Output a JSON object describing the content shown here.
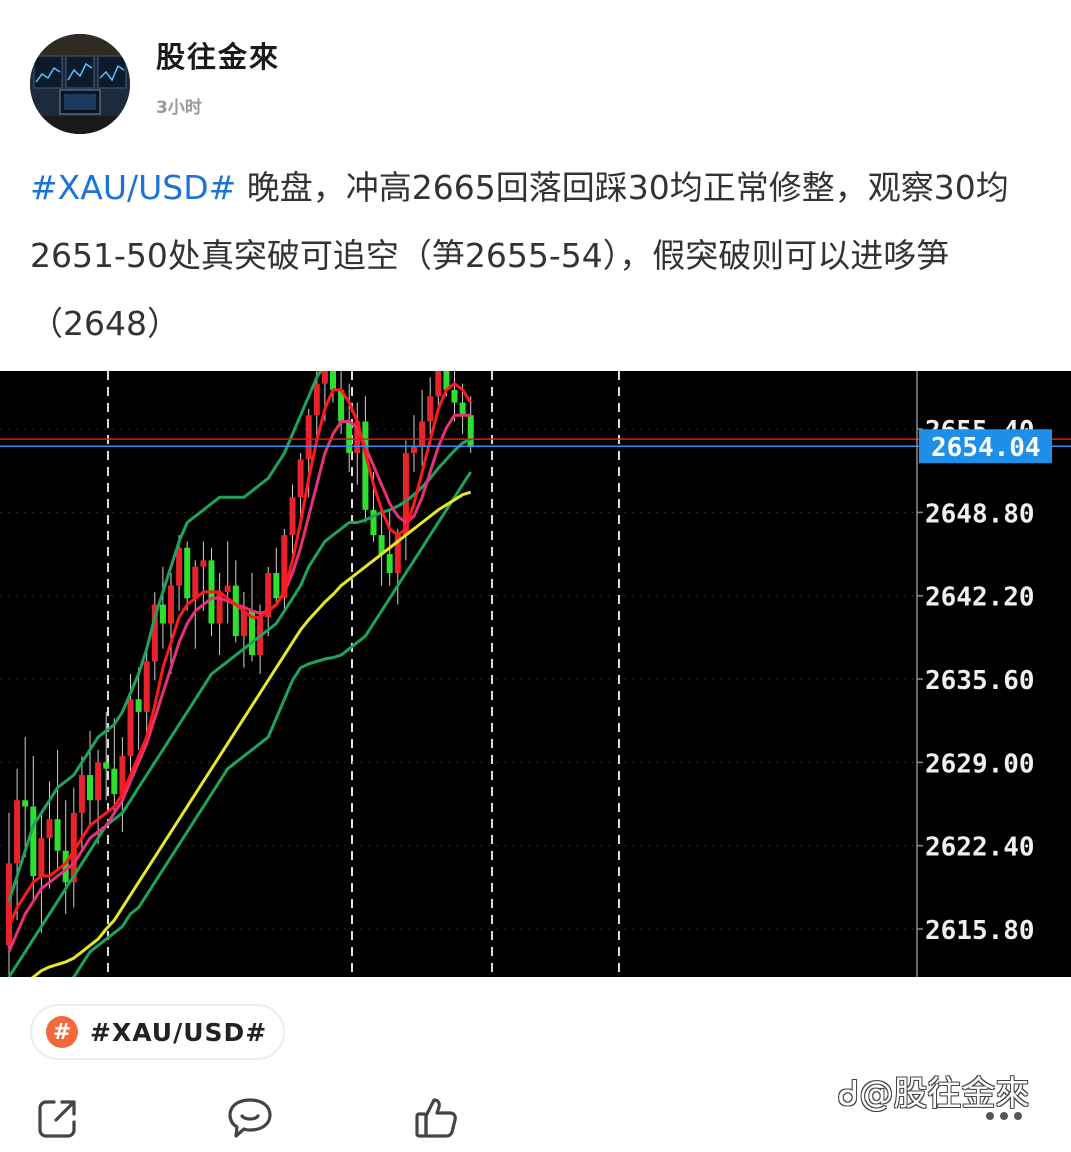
{
  "author": {
    "name": "股往金來",
    "time": "3小时"
  },
  "post": {
    "hashtag": "#XAU/USD#",
    "body": " 晚盘，冲高2665回落回踩30均正常修整，观察30均2651-50处真突破可追空（笋2655-54），假突破则可以进哆笋（2648）"
  },
  "chart_data": {
    "type": "candlestick",
    "symbol": "XAU/USD",
    "y_ticks": [
      "2615.80",
      "2622.40",
      "2629.00",
      "2635.60",
      "2642.20",
      "2648.80",
      "2655.40"
    ],
    "ylim": [
      2612.0,
      2660.0
    ],
    "current_price": "2654.04",
    "current_price_value": 2654.04,
    "red_line_value": 2654.6,
    "colors": {
      "up": "#e8232b",
      "down": "#2ee02e",
      "ma_fast": "#ff1a1a",
      "ma_mid": "#e8307a",
      "band": "#1fa35c",
      "ma_slow": "#e6e62a",
      "price_label_bg": "#1d8fe8",
      "price_line_red": "#d81f1f",
      "price_line_blue": "#3a8cf0"
    },
    "candles": [
      [
        2614.5,
        2625.0,
        2610.0,
        2621.0
      ],
      [
        2621.0,
        2628.5,
        2616.5,
        2626.0
      ],
      [
        2626.0,
        2631.0,
        2621.5,
        2625.5
      ],
      [
        2625.5,
        2629.5,
        2618.0,
        2620.0
      ],
      [
        2620.0,
        2625.0,
        2615.5,
        2623.0
      ],
      [
        2623.0,
        2627.5,
        2619.0,
        2624.5
      ],
      [
        2624.5,
        2630.0,
        2620.5,
        2622.0
      ],
      [
        2622.0,
        2626.0,
        2617.0,
        2619.5
      ],
      [
        2619.5,
        2627.0,
        2617.5,
        2625.0
      ],
      [
        2625.0,
        2629.5,
        2622.0,
        2628.0
      ],
      [
        2628.0,
        2631.5,
        2624.0,
        2626.0
      ],
      [
        2626.0,
        2630.0,
        2622.5,
        2629.0
      ],
      [
        2629.0,
        2633.0,
        2626.0,
        2628.5
      ],
      [
        2628.5,
        2632.5,
        2625.0,
        2626.5
      ],
      [
        2626.5,
        2631.0,
        2623.5,
        2629.5
      ],
      [
        2629.5,
        2636.0,
        2627.5,
        2634.0
      ],
      [
        2634.0,
        2636.5,
        2630.0,
        2633.0
      ],
      [
        2633.0,
        2638.0,
        2630.5,
        2637.0
      ],
      [
        2637.0,
        2642.5,
        2635.5,
        2641.5
      ],
      [
        2641.5,
        2644.5,
        2638.0,
        2640.0
      ],
      [
        2640.0,
        2644.0,
        2636.0,
        2643.0
      ],
      [
        2643.0,
        2647.0,
        2641.0,
        2646.0
      ],
      [
        2646.0,
        2646.5,
        2641.0,
        2642.0
      ],
      [
        2642.0,
        2645.0,
        2638.0,
        2644.5
      ],
      [
        2644.5,
        2646.5,
        2641.0,
        2645.0
      ],
      [
        2645.0,
        2646.0,
        2639.0,
        2640.0
      ],
      [
        2640.0,
        2644.0,
        2637.5,
        2642.5
      ],
      [
        2642.5,
        2646.5,
        2640.0,
        2643.0
      ],
      [
        2643.0,
        2645.0,
        2638.5,
        2639.0
      ],
      [
        2639.0,
        2642.5,
        2636.5,
        2641.0
      ],
      [
        2641.0,
        2644.0,
        2637.0,
        2637.5
      ],
      [
        2637.5,
        2641.5,
        2636.0,
        2640.5
      ],
      [
        2640.5,
        2644.5,
        2639.0,
        2644.0
      ],
      [
        2644.0,
        2646.0,
        2641.5,
        2642.0
      ],
      [
        2642.0,
        2647.5,
        2641.0,
        2647.0
      ],
      [
        2647.0,
        2651.0,
        2645.5,
        2650.0
      ],
      [
        2650.0,
        2653.5,
        2647.5,
        2653.0
      ],
      [
        2653.0,
        2657.0,
        2650.0,
        2656.5
      ],
      [
        2656.5,
        2660.0,
        2654.5,
        2659.0
      ],
      [
        2659.0,
        2661.0,
        2656.0,
        2660.5
      ],
      [
        2660.5,
        2661.5,
        2657.5,
        2658.5
      ],
      [
        2658.5,
        2661.0,
        2655.0,
        2656.0
      ],
      [
        2656.0,
        2659.0,
        2652.0,
        2653.5
      ],
      [
        2653.5,
        2657.5,
        2651.0,
        2656.0
      ],
      [
        2656.0,
        2658.0,
        2648.0,
        2649.0
      ],
      [
        2649.0,
        2652.0,
        2646.5,
        2647.0
      ],
      [
        2647.0,
        2649.0,
        2643.0,
        2645.5
      ],
      [
        2645.5,
        2649.0,
        2643.0,
        2644.0
      ],
      [
        2644.0,
        2647.5,
        2641.5,
        2647.0
      ],
      [
        2647.0,
        2654.5,
        2645.0,
        2653.5
      ],
      [
        2653.5,
        2656.5,
        2652.0,
        2654.0
      ],
      [
        2654.0,
        2658.5,
        2652.5,
        2656.0
      ],
      [
        2656.0,
        2659.5,
        2655.0,
        2658.0
      ],
      [
        2658.0,
        2661.0,
        2657.0,
        2660.0
      ],
      [
        2660.0,
        2661.5,
        2658.0,
        2658.5
      ],
      [
        2658.5,
        2661.0,
        2656.0,
        2657.5
      ],
      [
        2657.5,
        2659.0,
        2655.0,
        2656.5
      ],
      [
        2656.5,
        2658.0,
        2653.5,
        2654.0
      ]
    ],
    "ma_fast": [
      2616,
      2617.5,
      2618.5,
      2619.5,
      2620,
      2620,
      2620.5,
      2621,
      2622,
      2623,
      2624,
      2624.5,
      2625,
      2625.5,
      2626.5,
      2628,
      2629.5,
      2631,
      2633.5,
      2636.5,
      2638.5,
      2640.5,
      2641.5,
      2642,
      2642.5,
      2642.5,
      2642.5,
      2642,
      2641.5,
      2641,
      2640.5,
      2640.5,
      2641,
      2641.5,
      2642.5,
      2645,
      2648,
      2651.5,
      2654.5,
      2657,
      2658.5,
      2658.5,
      2657.5,
      2656,
      2653.5,
      2651,
      2649,
      2647.5,
      2647,
      2647.5,
      2649.5,
      2652,
      2654.5,
      2657,
      2658.5,
      2659,
      2658.5,
      2657.5
    ],
    "ma_mid": [
      2614,
      2615.5,
      2617,
      2618,
      2619,
      2619.5,
      2620,
      2620.5,
      2621,
      2622,
      2623,
      2623.5,
      2624,
      2625,
      2626,
      2627.5,
      2629,
      2630.5,
      2632.5,
      2634.5,
      2636.5,
      2638.5,
      2640,
      2641,
      2641.5,
      2642,
      2642,
      2641.8,
      2641.5,
      2641.3,
      2641,
      2640.8,
      2641,
      2641.5,
      2642.5,
      2644,
      2646,
      2648.5,
      2651,
      2653.5,
      2655,
      2656,
      2656,
      2655.5,
      2654,
      2652.5,
      2651,
      2649.5,
      2648.5,
      2648,
      2648.5,
      2650,
      2652,
      2654,
      2655.5,
      2656.5,
      2656.5,
      2656.5
    ],
    "band_upper": [
      2618,
      2620,
      2622,
      2624,
      2625,
      2626,
      2627,
      2627.5,
      2628,
      2629,
      2630,
      2631,
      2631.5,
      2632,
      2633,
      2634.5,
      2636,
      2638,
      2640.5,
      2642.5,
      2644.5,
      2646.5,
      2648,
      2648.5,
      2649,
      2649.5,
      2650,
      2650,
      2650,
      2650,
      2650.5,
      2651,
      2651.5,
      2652.5,
      2653.5,
      2655,
      2656.5,
      2658,
      2659.5,
      2660.5,
      2661,
      2661.5,
      2661.5,
      2661.5,
      2661.5,
      2661.5,
      2661.5,
      2661.5,
      2661.5,
      2661.5,
      2661.5,
      2661.5,
      2661.5,
      2661.5,
      2661.5,
      2661.5,
      2661.5,
      2661.5
    ],
    "band_mid": [
      2612,
      2613,
      2614,
      2615,
      2616,
      2617,
      2618,
      2619,
      2620,
      2621,
      2622,
      2623,
      2624,
      2624.5,
      2625,
      2626,
      2627,
      2628,
      2629,
      2630,
      2631,
      2632,
      2633,
      2634,
      2635,
      2636,
      2636.5,
      2637,
      2637.5,
      2638,
      2638.5,
      2639,
      2639.5,
      2640,
      2641,
      2642,
      2643,
      2644.5,
      2645.5,
      2646.5,
      2647,
      2647.5,
      2648,
      2648,
      2648.2,
      2648.5,
      2648.8,
      2649,
      2649.3,
      2649.7,
      2650.2,
      2650.8,
      2651.5,
      2652.3,
      2653,
      2653.7,
      2654.3,
      2654.6
    ],
    "ma_slow": [
      2610.5,
      2611,
      2611.5,
      2612,
      2612.5,
      2612.8,
      2613,
      2613.2,
      2613.5,
      2614,
      2614.5,
      2615,
      2615.8,
      2616.5,
      2617.5,
      2618.5,
      2619.5,
      2620.5,
      2621.5,
      2622.5,
      2623.5,
      2624.5,
      2625.5,
      2626.5,
      2627.5,
      2628.5,
      2629.5,
      2630.5,
      2631.5,
      2632.5,
      2633.5,
      2634.5,
      2635.5,
      2636.5,
      2637.5,
      2638.5,
      2639.5,
      2640.3,
      2641,
      2641.7,
      2642.3,
      2643,
      2643.5,
      2644,
      2644.5,
      2645,
      2645.5,
      2646,
      2646.5,
      2647,
      2647.5,
      2648,
      2648.5,
      2649,
      2649.4,
      2649.8,
      2650.2,
      2650.4
    ],
    "band_lower": [
      2604,
      2605,
      2606,
      2607,
      2608,
      2609,
      2610,
      2611,
      2612,
      2613,
      2614,
      2614.5,
      2615,
      2615.5,
      2616,
      2617,
      2617.5,
      2618.5,
      2619.5,
      2620.5,
      2621.5,
      2622.5,
      2623.5,
      2624.5,
      2625.5,
      2626.5,
      2627.5,
      2628.5,
      2629,
      2629.5,
      2630,
      2630.5,
      2631,
      2632.5,
      2634,
      2635.5,
      2636.5,
      2636.8,
      2637,
      2637.2,
      2637.3,
      2637.5,
      2638,
      2638.5,
      2639,
      2640,
      2641,
      2642,
      2643,
      2644,
      2645,
      2646,
      2647,
      2648,
      2649,
      2650,
      2651,
      2652
    ]
  },
  "tag_chip": {
    "icon": "#",
    "label": "#XAU/USD#"
  },
  "actions": {
    "share_icon": "share-icon",
    "comment_icon": "comment-icon",
    "like_icon": "thumbs-up-icon",
    "more_icon": "more-dots-icon"
  },
  "watermark": "ᑯ@股往金來"
}
